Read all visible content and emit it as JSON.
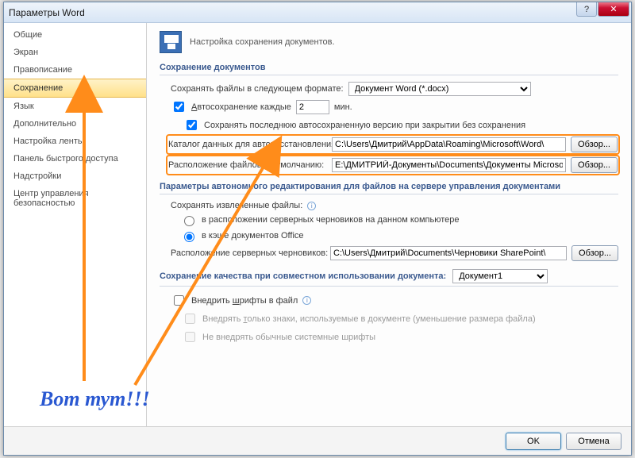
{
  "window": {
    "title": "Параметры Word",
    "help_btn": "?",
    "close_btn": "✕"
  },
  "sidebar": {
    "items": [
      "Общие",
      "Экран",
      "Правописание",
      "Сохранение",
      "Язык",
      "Дополнительно",
      "Настройка ленты",
      "Панель быстрого доступа",
      "Надстройки",
      "Центр управления безопасностью"
    ],
    "selected_index": 3
  },
  "header": {
    "text": "Настройка сохранения документов."
  },
  "section1": {
    "title": "Сохранение документов",
    "save_format_label": "Сохранять файлы в следующем формате:",
    "save_format_value": "Документ Word (*.docx)",
    "autosave_label": "Автосохранение каждые",
    "autosave_value": "2",
    "autosave_unit": "мин.",
    "keep_last_label": "Сохранять последнюю автосохраненную версию при закрытии без сохранения",
    "autorecover_dir_label": "Каталог данных для автовосстановления:",
    "autorecover_dir_value": "C:\\Users\\Дмитрий\\AppData\\Roaming\\Microsoft\\Word\\",
    "default_loc_label": "Расположение файлов по умолчанию:",
    "default_loc_value": "E:\\ДМИТРИЙ-Документы\\Documents\\Документы Microsoft Word",
    "browse": "Обзор..."
  },
  "section2": {
    "title": "Параметры автономного редактирования для файлов на сервере управления документами",
    "save_checked_label": "Сохранять извлеченные файлы:",
    "radio1": "в расположении серверных черновиков на данном компьютере",
    "radio2": "в кэше документов Office",
    "server_drafts_label": "Расположение серверных черновиков:",
    "server_drafts_value": "C:\\Users\\Дмитрий\\Documents\\Черновики SharePoint\\",
    "browse": "Обзор..."
  },
  "section3": {
    "title": "Сохранение качества при совместном использовании документа:",
    "doc_selector_value": "Документ1",
    "embed_fonts_label": "Внедрить шрифты в файл",
    "embed_only_chars": "Внедрять только знаки, используемые в документе (уменьшение размера файла)",
    "no_system_fonts": "Не внедрять обычные системные шрифты"
  },
  "footer": {
    "ok": "OK",
    "cancel": "Отмена"
  },
  "callout": {
    "text": "Вот тут!!!"
  }
}
